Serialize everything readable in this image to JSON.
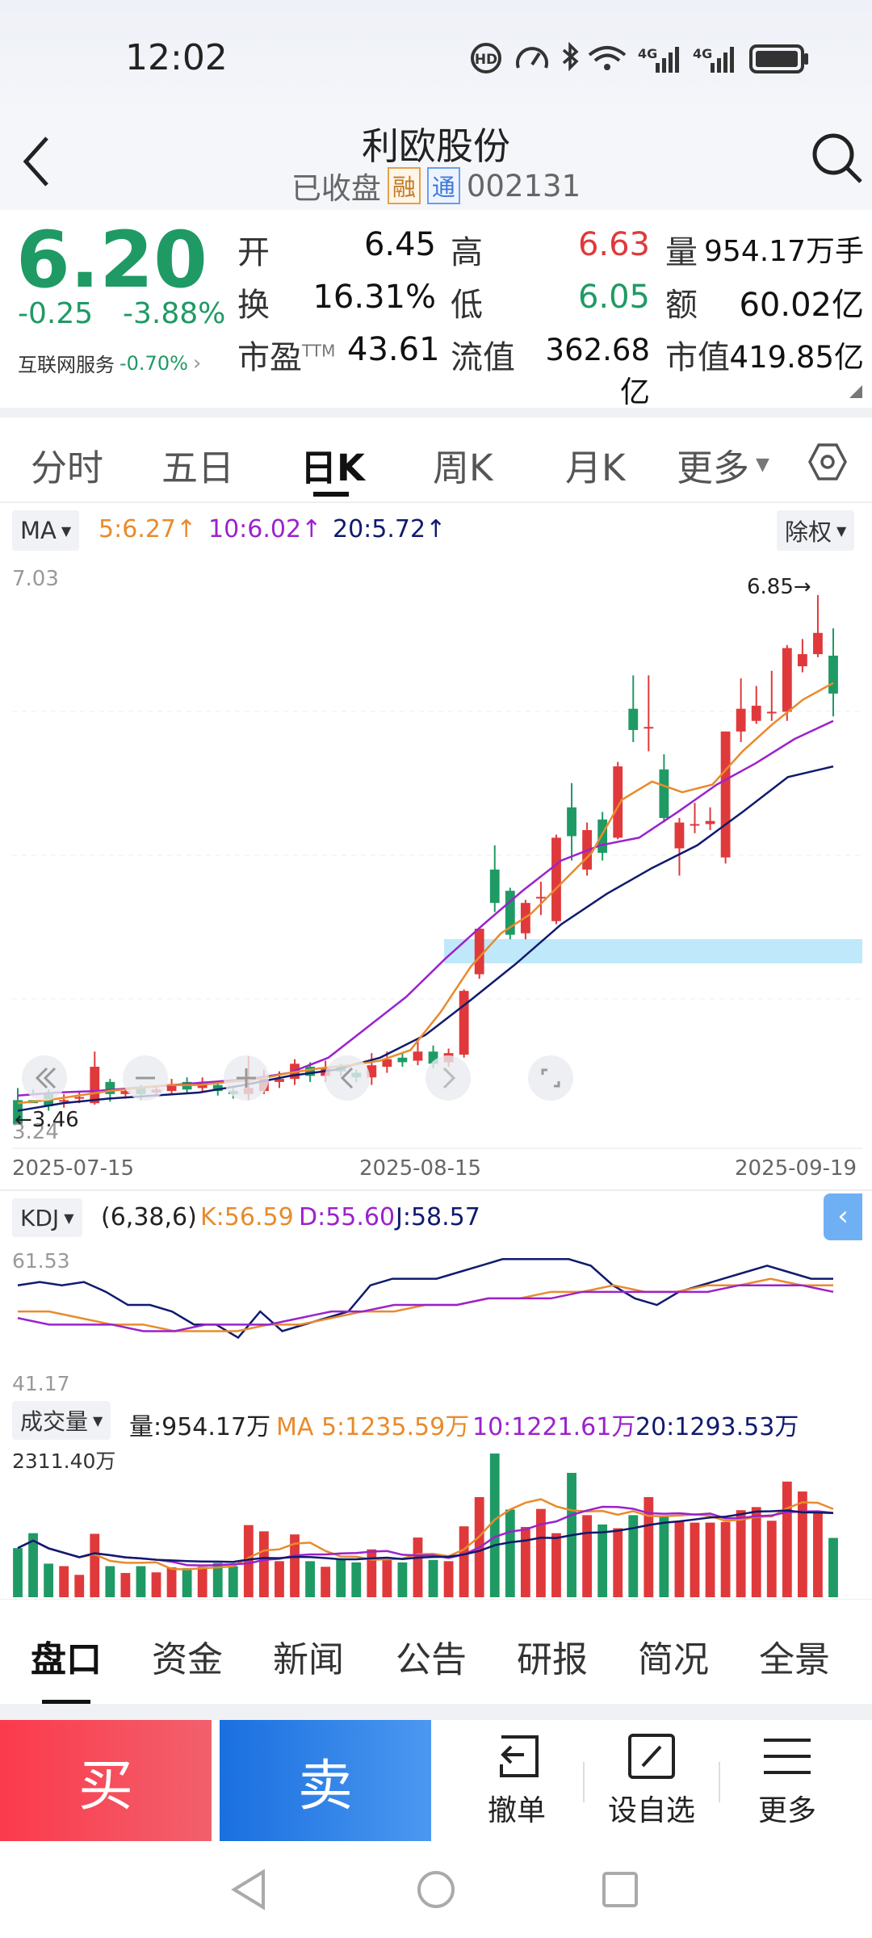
{
  "status": {
    "time": "12:02"
  },
  "header": {
    "title": "利欧股份",
    "status": "已收盘",
    "badge1": "融",
    "badge2": "通",
    "code": "002131"
  },
  "quote": {
    "price": "6.20",
    "change": "-0.25",
    "change_pct": "-3.88%",
    "sector": "互联网服务",
    "sector_pct": "-0.70%",
    "open_label": "开",
    "open": "6.45",
    "high_label": "高",
    "high": "6.63",
    "vol_label": "量",
    "vol": "954.17万手",
    "turn_label": "换",
    "turn": "16.31%",
    "low_label": "低",
    "low": "6.05",
    "amt_label": "额",
    "amt": "60.02亿",
    "pe_label": "市盈",
    "pe_sup": "TTM",
    "pe": "43.61",
    "float_label": "流值",
    "float": "362.68亿",
    "mcap_label": "市值",
    "mcap": "419.85亿"
  },
  "period_tabs": [
    "分时",
    "五日",
    "日K",
    "周K",
    "月K",
    "更多"
  ],
  "ma": {
    "selector": "MA",
    "ma5": "5:6.27↑",
    "ma10": "10:6.02↑",
    "ma20": "20:5.72↑",
    "adjust": "除权"
  },
  "kline": {
    "y_max": "7.03",
    "y_min": "3.24",
    "high_mark": "6.85→",
    "low_mark": "←3.46",
    "dates": [
      "2025-07-15",
      "2025-08-15",
      "2025-09-19"
    ]
  },
  "kdj": {
    "selector": "KDJ",
    "params": "(6,38,6)",
    "k": "K:56.59",
    "d": "D:55.60",
    "j": "J:58.57",
    "y_max": "61.53",
    "y_min": "41.17"
  },
  "volume": {
    "selector": "成交量",
    "vol": "量:954.17万",
    "ma5": "MA 5:1235.59万",
    "ma10": "10:1221.61万",
    "ma20": "20:1293.53万",
    "y_max": "2311.40万"
  },
  "bottom_tabs": [
    "盘口",
    "资金",
    "新闻",
    "公告",
    "研报",
    "简况",
    "全景"
  ],
  "actions": {
    "buy": "买",
    "sell": "卖",
    "cancel": "撤单",
    "watch": "设自选",
    "more": "更多"
  },
  "colors": {
    "up": "#e0393b",
    "down": "#1f9a64",
    "ma5": "#e88b2c",
    "ma10": "#9b22cc",
    "ma20": "#101a6e"
  },
  "chart_data": {
    "type": "candlestick",
    "categories_range": [
      "2025-07-15",
      "2025-09-19"
    ],
    "candles": [
      [
        3.52,
        3.36,
        3.6,
        3.46
      ],
      [
        3.52,
        3.5,
        3.56,
        3.59
      ],
      [
        3.56,
        3.48,
        3.45,
        3.59
      ],
      [
        3.52,
        3.52,
        3.47,
        3.56
      ],
      [
        3.54,
        3.54,
        3.5,
        3.57
      ],
      [
        3.5,
        3.74,
        3.49,
        3.84
      ],
      [
        3.64,
        3.56,
        3.51,
        3.66
      ],
      [
        3.56,
        3.58,
        3.53,
        3.6
      ],
      [
        3.6,
        3.56,
        3.52,
        3.62
      ],
      [
        3.57,
        3.59,
        3.55,
        3.61
      ],
      [
        3.58,
        3.62,
        3.56,
        3.66
      ],
      [
        3.64,
        3.59,
        3.56,
        3.67
      ],
      [
        3.6,
        3.64,
        3.58,
        3.67
      ],
      [
        3.62,
        3.58,
        3.55,
        3.64
      ],
      [
        3.58,
        3.56,
        3.53,
        3.6
      ],
      [
        3.56,
        3.6,
        3.52,
        3.81
      ],
      [
        3.58,
        3.66,
        3.56,
        3.72
      ],
      [
        3.64,
        3.66,
        3.6,
        3.71
      ],
      [
        3.66,
        3.76,
        3.62,
        3.79
      ],
      [
        3.74,
        3.68,
        3.64,
        3.77
      ],
      [
        3.68,
        3.73,
        3.64,
        3.78
      ],
      [
        3.74,
        3.71,
        3.68,
        3.76
      ],
      [
        3.7,
        3.67,
        3.64,
        3.72
      ],
      [
        3.67,
        3.75,
        3.62,
        3.83
      ],
      [
        3.74,
        3.79,
        3.7,
        3.84
      ],
      [
        3.8,
        3.77,
        3.74,
        3.83
      ],
      [
        3.78,
        3.84,
        3.75,
        3.93
      ],
      [
        3.84,
        3.76,
        3.73,
        3.88
      ],
      [
        3.77,
        3.83,
        3.74,
        3.86
      ],
      [
        3.82,
        4.24,
        3.8,
        4.25
      ],
      [
        4.35,
        4.65,
        4.32,
        4.66
      ],
      [
        5.04,
        4.82,
        4.76,
        5.2
      ],
      [
        4.9,
        4.61,
        4.58,
        4.92
      ],
      [
        4.62,
        4.82,
        4.58,
        4.84
      ],
      [
        4.86,
        4.86,
        4.74,
        4.96
      ],
      [
        4.7,
        5.25,
        4.68,
        5.27
      ],
      [
        5.45,
        5.26,
        5.1,
        5.61
      ],
      [
        5.04,
        5.3,
        5.0,
        5.35
      ],
      [
        5.37,
        5.15,
        5.1,
        5.42
      ],
      [
        5.25,
        5.72,
        5.24,
        5.75
      ],
      [
        6.1,
        5.96,
        5.88,
        6.32
      ],
      [
        5.98,
        5.98,
        5.82,
        6.32
      ],
      [
        5.7,
        5.38,
        5.35,
        5.8
      ],
      [
        5.18,
        5.35,
        5.0,
        5.38
      ],
      [
        5.34,
        5.34,
        5.28,
        5.48
      ],
      [
        5.34,
        5.36,
        5.3,
        5.45
      ],
      [
        5.12,
        5.95,
        5.08,
        5.95
      ],
      [
        5.95,
        6.1,
        5.88,
        6.3
      ],
      [
        6.02,
        6.12,
        6.0,
        6.25
      ],
      [
        6.08,
        6.08,
        6.02,
        6.35
      ],
      [
        6.08,
        6.5,
        6.02,
        6.52
      ],
      [
        6.38,
        6.46,
        6.34,
        6.56
      ],
      [
        6.46,
        6.6,
        6.44,
        6.85
      ],
      [
        6.45,
        6.2,
        6.05,
        6.63
      ]
    ],
    "volume_wan": [
      790,
      1030,
      540,
      500,
      360,
      1020,
      500,
      390,
      500,
      400,
      480,
      470,
      490,
      550,
      500,
      1160,
      1060,
      580,
      1010,
      580,
      490,
      620,
      560,
      770,
      600,
      560,
      960,
      600,
      580,
      1140,
      1610,
      2311,
      1410,
      1130,
      1420,
      1030,
      2000,
      1320,
      1170,
      1110,
      1320,
      1610,
      1310,
      1220,
      1200,
      1200,
      1210,
      1400,
      1450,
      1230,
      1860,
      1700,
      1350,
      954
    ],
    "ma5": [
      3.5,
      3.52,
      3.55,
      3.58,
      3.6,
      3.62,
      3.62,
      3.64,
      3.66,
      3.7,
      3.73,
      3.75,
      3.78,
      3.85,
      4.1,
      4.4,
      4.62,
      4.75,
      4.95,
      5.15,
      5.5,
      5.62,
      5.55,
      5.6,
      5.82,
      6.0,
      6.16,
      6.27
    ],
    "ma10": [
      3.55,
      3.57,
      3.58,
      3.6,
      3.62,
      3.64,
      3.66,
      3.7,
      3.8,
      4.0,
      4.2,
      4.45,
      4.68,
      4.9,
      5.1,
      5.2,
      5.25,
      5.42,
      5.6,
      5.74,
      5.9,
      6.02
    ],
    "ma20": [
      3.45,
      3.5,
      3.53,
      3.55,
      3.57,
      3.62,
      3.68,
      3.72,
      3.8,
      3.95,
      4.18,
      4.42,
      4.68,
      4.88,
      5.05,
      5.2,
      5.42,
      5.65,
      5.72
    ],
    "kdj_k": [
      57,
      57.5,
      57,
      57.5,
      56,
      54,
      54,
      53,
      51,
      51,
      49,
      53,
      50,
      51,
      52,
      53,
      57,
      58,
      58,
      58,
      59,
      60,
      61,
      61,
      61,
      61,
      60,
      57,
      55,
      54,
      56,
      57,
      58,
      59,
      60,
      59,
      58,
      58
    ],
    "kdj_d": [
      53,
      53,
      52,
      51,
      51,
      50,
      50,
      50,
      51,
      51,
      52,
      53,
      53,
      54,
      54,
      55,
      55,
      56,
      56,
      57,
      56,
      56,
      57,
      57,
      58,
      57,
      57
    ],
    "kdj_j": [
      52,
      51,
      51,
      51,
      50,
      50,
      51,
      51,
      51,
      52,
      53,
      53,
      54,
      54,
      54,
      55,
      55,
      55,
      56,
      56,
      56,
      56,
      56,
      57,
      57,
      57,
      56
    ]
  }
}
